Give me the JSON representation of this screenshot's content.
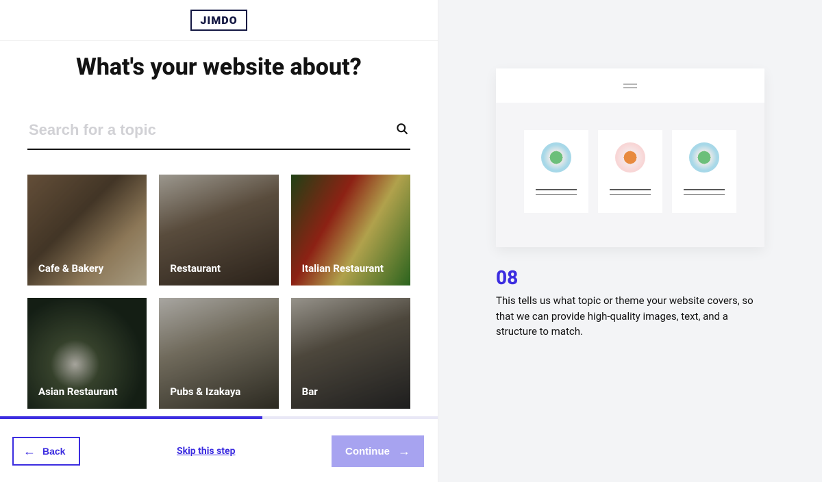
{
  "brand": "JIMDO",
  "heading": "What's your website about?",
  "search": {
    "placeholder": "Search for a topic"
  },
  "tiles": [
    {
      "label": "Cafe & Bakery"
    },
    {
      "label": "Restaurant"
    },
    {
      "label": "Italian Restaurant"
    },
    {
      "label": "Asian Restaurant"
    },
    {
      "label": "Pubs & Izakaya"
    },
    {
      "label": "Bar"
    }
  ],
  "footer": {
    "back": "Back",
    "skip": "Skip this step",
    "continue": "Continue"
  },
  "info": {
    "step": "08",
    "description": "This tells us what topic or theme your website covers, so that we can provide high-quality images, text, and a structure to match."
  },
  "progress_percent": 60
}
